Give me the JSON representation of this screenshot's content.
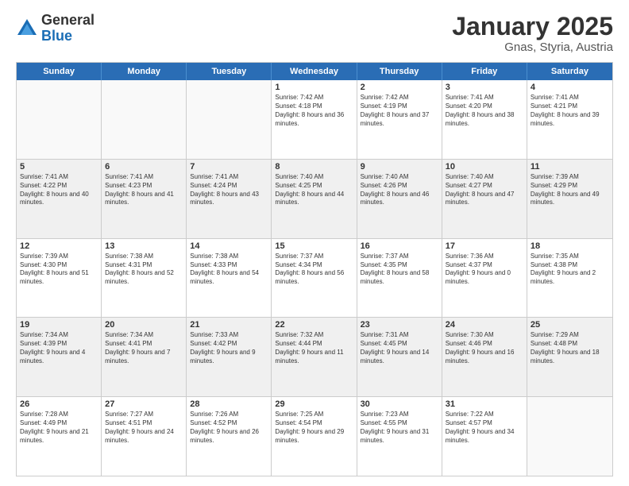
{
  "header": {
    "logo": {
      "general": "General",
      "blue": "Blue"
    },
    "title": "January 2025",
    "subtitle": "Gnas, Styria, Austria"
  },
  "weekdays": [
    "Sunday",
    "Monday",
    "Tuesday",
    "Wednesday",
    "Thursday",
    "Friday",
    "Saturday"
  ],
  "rows": [
    [
      {
        "day": "",
        "empty": true
      },
      {
        "day": "",
        "empty": true
      },
      {
        "day": "",
        "empty": true
      },
      {
        "day": "1",
        "sunrise": "Sunrise: 7:42 AM",
        "sunset": "Sunset: 4:18 PM",
        "daylight": "Daylight: 8 hours and 36 minutes."
      },
      {
        "day": "2",
        "sunrise": "Sunrise: 7:42 AM",
        "sunset": "Sunset: 4:19 PM",
        "daylight": "Daylight: 8 hours and 37 minutes."
      },
      {
        "day": "3",
        "sunrise": "Sunrise: 7:41 AM",
        "sunset": "Sunset: 4:20 PM",
        "daylight": "Daylight: 8 hours and 38 minutes."
      },
      {
        "day": "4",
        "sunrise": "Sunrise: 7:41 AM",
        "sunset": "Sunset: 4:21 PM",
        "daylight": "Daylight: 8 hours and 39 minutes."
      }
    ],
    [
      {
        "day": "5",
        "sunrise": "Sunrise: 7:41 AM",
        "sunset": "Sunset: 4:22 PM",
        "daylight": "Daylight: 8 hours and 40 minutes."
      },
      {
        "day": "6",
        "sunrise": "Sunrise: 7:41 AM",
        "sunset": "Sunset: 4:23 PM",
        "daylight": "Daylight: 8 hours and 41 minutes."
      },
      {
        "day": "7",
        "sunrise": "Sunrise: 7:41 AM",
        "sunset": "Sunset: 4:24 PM",
        "daylight": "Daylight: 8 hours and 43 minutes."
      },
      {
        "day": "8",
        "sunrise": "Sunrise: 7:40 AM",
        "sunset": "Sunset: 4:25 PM",
        "daylight": "Daylight: 8 hours and 44 minutes."
      },
      {
        "day": "9",
        "sunrise": "Sunrise: 7:40 AM",
        "sunset": "Sunset: 4:26 PM",
        "daylight": "Daylight: 8 hours and 46 minutes."
      },
      {
        "day": "10",
        "sunrise": "Sunrise: 7:40 AM",
        "sunset": "Sunset: 4:27 PM",
        "daylight": "Daylight: 8 hours and 47 minutes."
      },
      {
        "day": "11",
        "sunrise": "Sunrise: 7:39 AM",
        "sunset": "Sunset: 4:29 PM",
        "daylight": "Daylight: 8 hours and 49 minutes."
      }
    ],
    [
      {
        "day": "12",
        "sunrise": "Sunrise: 7:39 AM",
        "sunset": "Sunset: 4:30 PM",
        "daylight": "Daylight: 8 hours and 51 minutes."
      },
      {
        "day": "13",
        "sunrise": "Sunrise: 7:38 AM",
        "sunset": "Sunset: 4:31 PM",
        "daylight": "Daylight: 8 hours and 52 minutes."
      },
      {
        "day": "14",
        "sunrise": "Sunrise: 7:38 AM",
        "sunset": "Sunset: 4:33 PM",
        "daylight": "Daylight: 8 hours and 54 minutes."
      },
      {
        "day": "15",
        "sunrise": "Sunrise: 7:37 AM",
        "sunset": "Sunset: 4:34 PM",
        "daylight": "Daylight: 8 hours and 56 minutes."
      },
      {
        "day": "16",
        "sunrise": "Sunrise: 7:37 AM",
        "sunset": "Sunset: 4:35 PM",
        "daylight": "Daylight: 8 hours and 58 minutes."
      },
      {
        "day": "17",
        "sunrise": "Sunrise: 7:36 AM",
        "sunset": "Sunset: 4:37 PM",
        "daylight": "Daylight: 9 hours and 0 minutes."
      },
      {
        "day": "18",
        "sunrise": "Sunrise: 7:35 AM",
        "sunset": "Sunset: 4:38 PM",
        "daylight": "Daylight: 9 hours and 2 minutes."
      }
    ],
    [
      {
        "day": "19",
        "sunrise": "Sunrise: 7:34 AM",
        "sunset": "Sunset: 4:39 PM",
        "daylight": "Daylight: 9 hours and 4 minutes."
      },
      {
        "day": "20",
        "sunrise": "Sunrise: 7:34 AM",
        "sunset": "Sunset: 4:41 PM",
        "daylight": "Daylight: 9 hours and 7 minutes."
      },
      {
        "day": "21",
        "sunrise": "Sunrise: 7:33 AM",
        "sunset": "Sunset: 4:42 PM",
        "daylight": "Daylight: 9 hours and 9 minutes."
      },
      {
        "day": "22",
        "sunrise": "Sunrise: 7:32 AM",
        "sunset": "Sunset: 4:44 PM",
        "daylight": "Daylight: 9 hours and 11 minutes."
      },
      {
        "day": "23",
        "sunrise": "Sunrise: 7:31 AM",
        "sunset": "Sunset: 4:45 PM",
        "daylight": "Daylight: 9 hours and 14 minutes."
      },
      {
        "day": "24",
        "sunrise": "Sunrise: 7:30 AM",
        "sunset": "Sunset: 4:46 PM",
        "daylight": "Daylight: 9 hours and 16 minutes."
      },
      {
        "day": "25",
        "sunrise": "Sunrise: 7:29 AM",
        "sunset": "Sunset: 4:48 PM",
        "daylight": "Daylight: 9 hours and 18 minutes."
      }
    ],
    [
      {
        "day": "26",
        "sunrise": "Sunrise: 7:28 AM",
        "sunset": "Sunset: 4:49 PM",
        "daylight": "Daylight: 9 hours and 21 minutes."
      },
      {
        "day": "27",
        "sunrise": "Sunrise: 7:27 AM",
        "sunset": "Sunset: 4:51 PM",
        "daylight": "Daylight: 9 hours and 24 minutes."
      },
      {
        "day": "28",
        "sunrise": "Sunrise: 7:26 AM",
        "sunset": "Sunset: 4:52 PM",
        "daylight": "Daylight: 9 hours and 26 minutes."
      },
      {
        "day": "29",
        "sunrise": "Sunrise: 7:25 AM",
        "sunset": "Sunset: 4:54 PM",
        "daylight": "Daylight: 9 hours and 29 minutes."
      },
      {
        "day": "30",
        "sunrise": "Sunrise: 7:23 AM",
        "sunset": "Sunset: 4:55 PM",
        "daylight": "Daylight: 9 hours and 31 minutes."
      },
      {
        "day": "31",
        "sunrise": "Sunrise: 7:22 AM",
        "sunset": "Sunset: 4:57 PM",
        "daylight": "Daylight: 9 hours and 34 minutes."
      },
      {
        "day": "",
        "empty": true
      }
    ]
  ]
}
